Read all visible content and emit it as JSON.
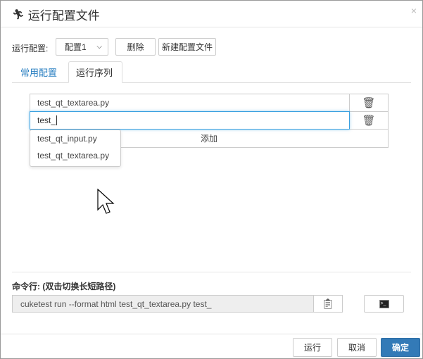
{
  "dialog": {
    "title": "运行配置文件",
    "close_label": "×"
  },
  "config": {
    "label": "运行配置:",
    "selected": "配置1",
    "delete_label": "删除",
    "new_label": "新建配置文件"
  },
  "tabs": [
    {
      "label": "常用配置"
    },
    {
      "label": "运行序列"
    }
  ],
  "sequence": {
    "items": [
      "test_qt_textarea.py",
      "test_"
    ],
    "add_label": "添加"
  },
  "autocomplete": [
    "test_qt_input.py",
    "test_qt_textarea.py"
  ],
  "command": {
    "label": "命令行: (双击切换长短路径)",
    "value": "cuketest run --format html test_qt_textarea.py test_"
  },
  "footer": {
    "run_label": "运行",
    "cancel_label": "取消",
    "ok_label": "确定"
  },
  "colors": {
    "primary": "#337ab7",
    "link": "#2a7fc1",
    "focus": "#39a0e0"
  }
}
